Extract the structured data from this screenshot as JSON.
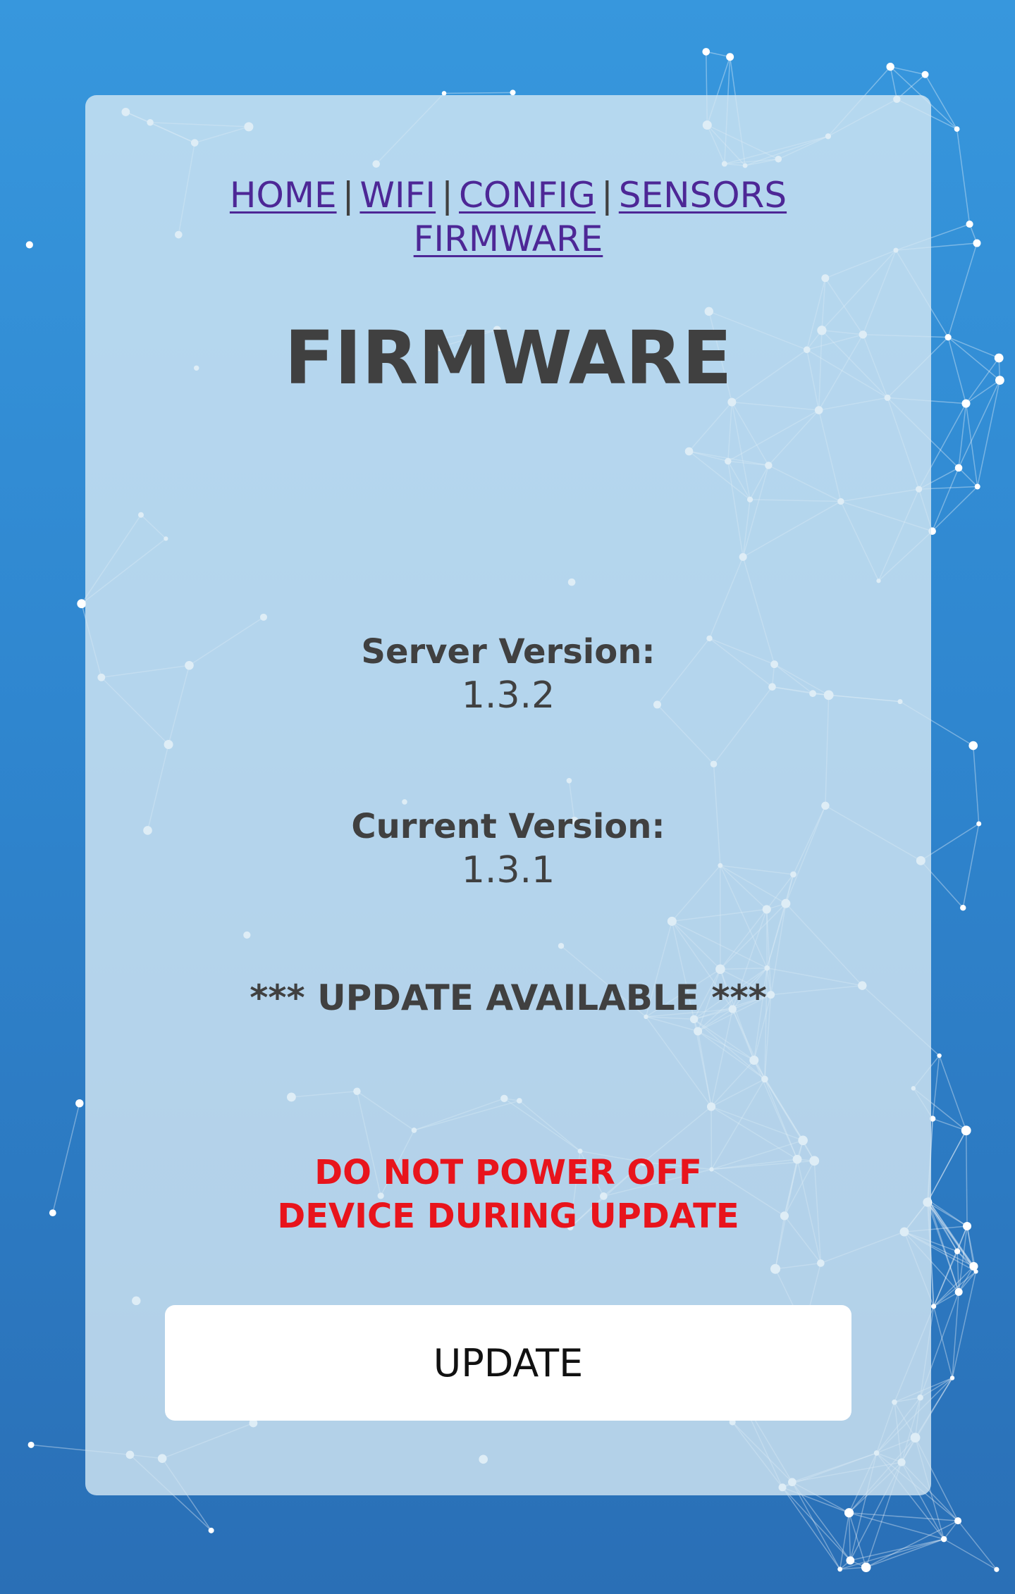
{
  "background": {
    "icon": "network-constellation",
    "gradient_top": "#3797dd",
    "gradient_bottom": "#2a6fb6"
  },
  "nav": {
    "links": [
      "HOME",
      "WIFI",
      "CONFIG",
      "SENSORS",
      "FIRMWARE"
    ],
    "separator": "|",
    "link_color": "#4d2796"
  },
  "page": {
    "title": "FIRMWARE"
  },
  "server": {
    "label": "Server Version:",
    "version": "1.3.2"
  },
  "current": {
    "label": "Current Version:",
    "version": "1.3.1"
  },
  "status": {
    "message": "*** UPDATE AVAILABLE ***"
  },
  "warning": {
    "text": "DO NOT POWER OFF DEVICE DURING UPDATE",
    "color": "#e8141c"
  },
  "actions": {
    "update_label": "UPDATE"
  }
}
